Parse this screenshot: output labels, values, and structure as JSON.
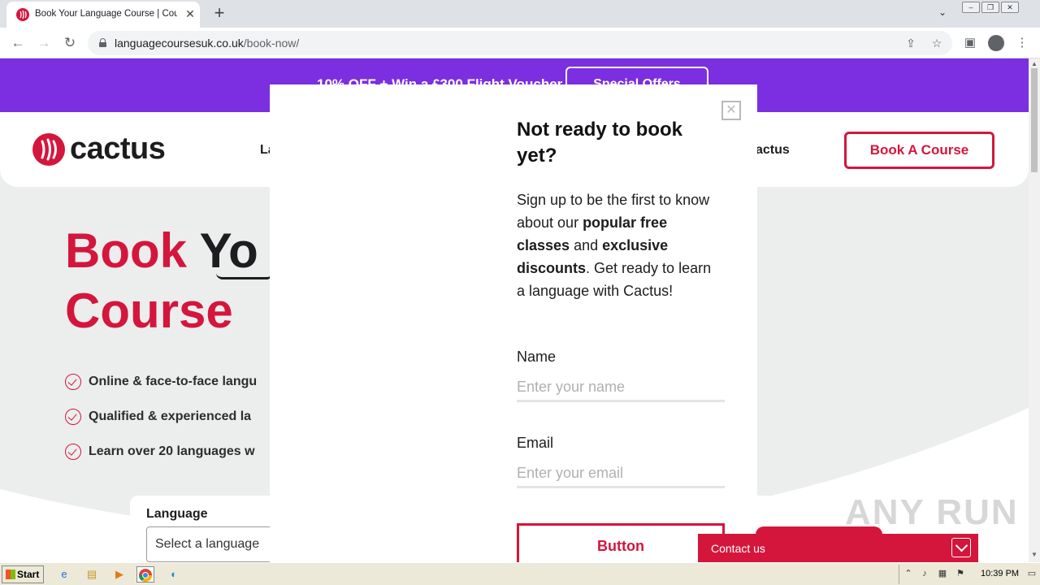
{
  "browser": {
    "tab_title": "Book Your Language Course | Cours",
    "tab_close": "✕",
    "new_tab": "+",
    "url_domain": "languagecoursesuk.co.uk",
    "url_path": "/book-now/",
    "icons": [
      "back-arrow-icon",
      "forward-arrow-icon",
      "reload-icon",
      "lock-icon",
      "share-icon",
      "star-icon",
      "sidepanel-icon",
      "profile-icon",
      "kebab-menu-icon"
    ]
  },
  "promo": {
    "text": "10% OFF + Win a £300 Flight Voucher",
    "button": "Special Offers"
  },
  "header": {
    "logo_text": "cactus",
    "nav_partial": "La",
    "nav_about_partial": "actus",
    "book_button": "Book A Course"
  },
  "hero": {
    "title_line1_word1": "Book",
    "title_line1_word2": "Yo",
    "title_line2": "Course",
    "features": [
      "Online & face-to-face langu",
      "Qualified & experienced la",
      "Learn over 20 languages w"
    ]
  },
  "form": {
    "language_label": "Language",
    "language_select": "Select a language"
  },
  "modal": {
    "close_glyph": "✕",
    "title": "Not ready to book yet?",
    "body_1": "Sign up to be the first to know about our ",
    "body_bold_1": "popular free classes",
    "body_2": " and ",
    "body_bold_2": "exclusive discounts",
    "body_3": ". Get ready to learn a language with Cactus!",
    "name_label": "Name",
    "name_placeholder": "Enter your name",
    "email_label": "Email",
    "email_placeholder": "Enter your email",
    "button": "Button"
  },
  "contact": {
    "label": "Contact us"
  },
  "watermark": "ANY RUN",
  "taskbar": {
    "start": "Start",
    "clock": "10:39 PM"
  },
  "colors": {
    "brand_red": "#d4163c",
    "promo_purple": "#7b2fe0"
  }
}
